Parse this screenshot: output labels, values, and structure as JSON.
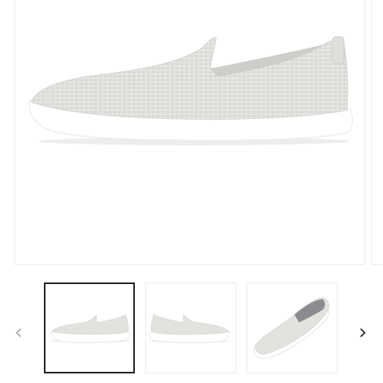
{
  "gallery": {
    "main_image": {
      "icon": "shoe-side-view-image",
      "color": "#e4e3e0",
      "sole_color": "#ffffff"
    },
    "thumbnails": [
      {
        "icon": "shoe-side-right-thumbnail",
        "selected": true
      },
      {
        "icon": "shoe-side-left-thumbnail",
        "selected": false
      },
      {
        "icon": "shoe-three-quarter-thumbnail",
        "selected": false
      }
    ],
    "prev_icon": "chevron-left-icon",
    "next_icon": "chevron-right-icon",
    "colors": {
      "selected_border": "#1f2528",
      "frame_border": "#ececec",
      "arrow_inactive": "#9a9a9a",
      "arrow_active": "#222222"
    }
  }
}
